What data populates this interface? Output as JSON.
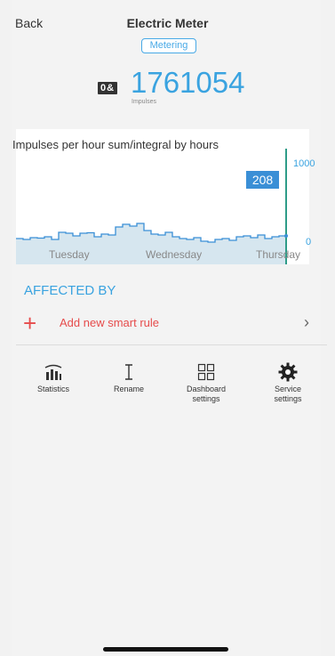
{
  "header": {
    "back_label": "Back",
    "title": "Electric Meter",
    "badge": "Metering"
  },
  "meter": {
    "value": "1761054",
    "unit": "Impulses",
    "icon": "meter-counter-icon",
    "icon_glyph": "0&"
  },
  "chart": {
    "title": "Impulses per hour sum/integral by hours",
    "current_value": "208",
    "y_max_label": "1000",
    "y_min_label": "0",
    "x_labels": [
      "Tuesday",
      "Wednesday",
      "Thursday"
    ],
    "colors": {
      "line": "#3a8fd6",
      "fill": "#d6e6ef",
      "cursor": "#2e9c88",
      "value_box": "#3a8fd6"
    }
  },
  "chart_data": {
    "type": "area",
    "title": "Impulses per hour sum/integral by hours",
    "xlabel": "",
    "ylabel": "",
    "ylim": [
      0,
      1000
    ],
    "x_ticks": [
      "Tuesday",
      "Wednesday",
      "Thursday"
    ],
    "values": [
      70,
      60,
      80,
      75,
      90,
      60,
      140,
      130,
      100,
      130,
      135,
      90,
      120,
      110,
      200,
      230,
      210,
      240,
      160,
      120,
      110,
      140,
      90,
      70,
      60,
      80,
      40,
      30,
      60,
      70,
      50,
      90,
      100,
      80,
      110,
      70,
      90,
      100
    ],
    "current_value": 208
  },
  "affected": {
    "heading": "AFFECTED BY",
    "add_rule_label": "Add new smart rule"
  },
  "actions": [
    {
      "label": "Statistics",
      "icon": "statistics-icon"
    },
    {
      "label": "Rename",
      "icon": "rename-icon"
    },
    {
      "label": "Dashboard\nsettings",
      "icon": "dashboard-icon"
    },
    {
      "label": "Service\nsettings",
      "icon": "gear-icon"
    }
  ]
}
